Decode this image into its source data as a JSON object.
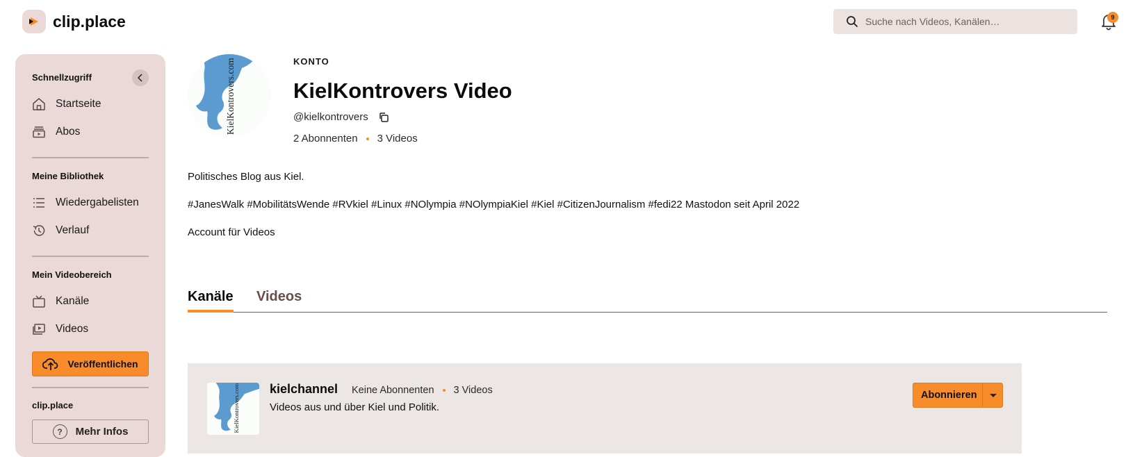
{
  "header": {
    "app_name": "clip.place",
    "search_placeholder": "Suche nach Videos, Kanälen…",
    "notification_count": "9"
  },
  "sidebar": {
    "quick_access_heading": "Schnellzugriff",
    "quick_access": [
      {
        "label": "Startseite",
        "icon": "home-icon"
      },
      {
        "label": "Abos",
        "icon": "subscriptions-icon"
      }
    ],
    "library_heading": "Meine Bibliothek",
    "library": [
      {
        "label": "Wiedergabelisten",
        "icon": "playlist-icon"
      },
      {
        "label": "Verlauf",
        "icon": "history-icon"
      }
    ],
    "video_area_heading": "Mein Videobereich",
    "video_area": [
      {
        "label": "Kanäle",
        "icon": "tv-icon"
      },
      {
        "label": "Videos",
        "icon": "video-library-icon"
      }
    ],
    "publish_label": "Veröffentlichen",
    "instance_heading": "clip.place",
    "more_info_label": "Mehr Infos"
  },
  "account": {
    "kicker": "KONTO",
    "display_name": "KielKontrovers Video",
    "handle": "@kielkontrovers",
    "subscribers": "2 Abonnenten",
    "videos": "3 Videos",
    "avatar_text": "KielKontrovers.com",
    "description": [
      "Politisches Blog aus Kiel.",
      "#JanesWalk #MobilitätsWende #RVkiel #Linux #NOlympia #NOlympiaKiel #Kiel #CitizenJournalism #fedi22 Mastodon seit April 2022",
      "Account für Videos"
    ]
  },
  "tabs": [
    {
      "label": "Kanäle",
      "active": true
    },
    {
      "label": "Videos",
      "active": false
    }
  ],
  "channel": {
    "name": "kielchannel",
    "subscribers": "Keine Abonnenten",
    "videos": "3 Videos",
    "description": "Videos aus und über Kiel und Politik.",
    "subscribe_label": "Abonnieren",
    "avatar_text": "KielKontrovers.com"
  },
  "colors": {
    "accent": "#f88b2a",
    "sidebar_bg": "#ead9d6",
    "card_bg": "#ece6e4",
    "avatar_blue": "#5b9bd0"
  }
}
